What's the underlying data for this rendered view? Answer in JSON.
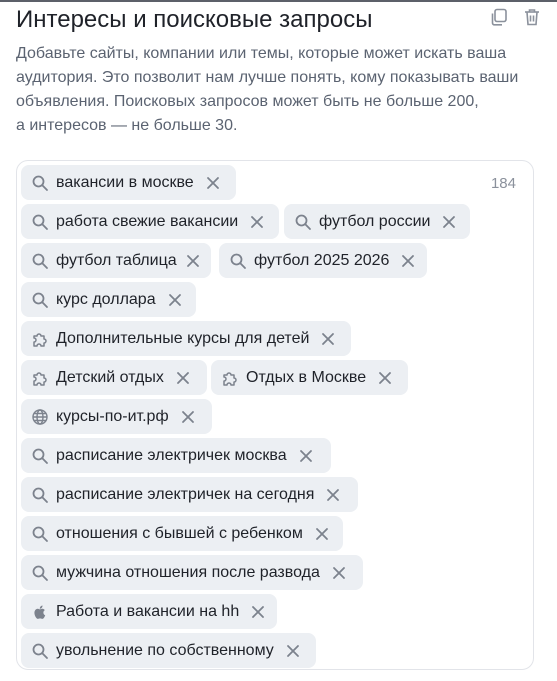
{
  "header": {
    "title": "Интересы и поисковые запросы",
    "actions": {
      "copy_icon": "copy-icon",
      "delete_icon": "trash-icon"
    }
  },
  "description": {
    "lines": [
      "Добавьте сайты, компании или темы, которые может искать ваша",
      "аудитория. Это позволит нам лучше понять, кому показывать ваши",
      "объявления. Поисковых запросов может быть не больше 200,",
      "а интересов — не больше 30."
    ]
  },
  "tags": {
    "remaining_count": "184",
    "items": [
      {
        "type": "search",
        "icon": "search-icon",
        "label": "вакансии в москве"
      },
      {
        "type": "search",
        "icon": "search-icon",
        "label": "работа свежие вакансии"
      },
      {
        "type": "search",
        "icon": "search-icon",
        "label": "футбол россии"
      },
      {
        "type": "search",
        "icon": "search-icon",
        "label": "футбол таблица"
      },
      {
        "type": "search",
        "icon": "search-icon",
        "label": "футбол 2025 2026"
      },
      {
        "type": "search",
        "icon": "search-icon",
        "label": "курс доллара"
      },
      {
        "type": "interest",
        "icon": "puzzle-icon",
        "label": "Дополнительные курсы для детей"
      },
      {
        "type": "interest",
        "icon": "puzzle-icon",
        "label": "Детский отдых"
      },
      {
        "type": "interest",
        "icon": "puzzle-icon",
        "label": "Отдых в Москве"
      },
      {
        "type": "site",
        "icon": "globe-icon",
        "label": "курсы-по-ит.рф"
      },
      {
        "type": "search",
        "icon": "search-icon",
        "label": "расписание электричек москва"
      },
      {
        "type": "search",
        "icon": "search-icon",
        "label": "расписание электричек на сегодня"
      },
      {
        "type": "search",
        "icon": "search-icon",
        "label": "отношения с бывшей с ребенком"
      },
      {
        "type": "search",
        "icon": "search-icon",
        "label": "мужчина отношения после развода"
      },
      {
        "type": "app",
        "icon": "apple-icon",
        "label": "Работа и вакансии на hh"
      },
      {
        "type": "search",
        "icon": "search-icon",
        "label": "увольнение по собственному"
      }
    ]
  },
  "colors": {
    "chip_bg": "#eceff3",
    "text_primary": "#1f2229",
    "text_secondary": "#5b6371",
    "icon": "#7c828d",
    "border": "#e2e4e9"
  }
}
